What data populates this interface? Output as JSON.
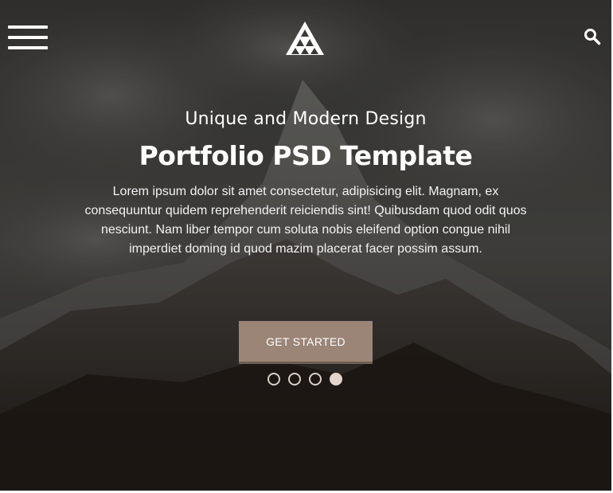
{
  "header": {
    "menu_icon": "hamburger-menu-icon",
    "logo_icon": "triangle-logo-icon",
    "search_icon": "search-icon"
  },
  "hero": {
    "subtitle": "Unique and Modern Design",
    "title": "Portfolio PSD Template",
    "description": "Lorem ipsum dolor sit amet consectetur, adipisicing elit. Magnam, ex consequuntur quidem reprehenderit reiciendis sint! Quibusdam quod odit quos nesciunt. Nam liber tempor cum soluta nobis eleifend option congue nihil imperdiet doming id quod mazim placerat facer possim assum.",
    "cta_label": "GET STARTED"
  },
  "slider": {
    "total": 4,
    "active_index": 4
  },
  "colors": {
    "accent": "#9b8577",
    "dot_active": "#e3d6cc",
    "text": "#ffffff"
  }
}
